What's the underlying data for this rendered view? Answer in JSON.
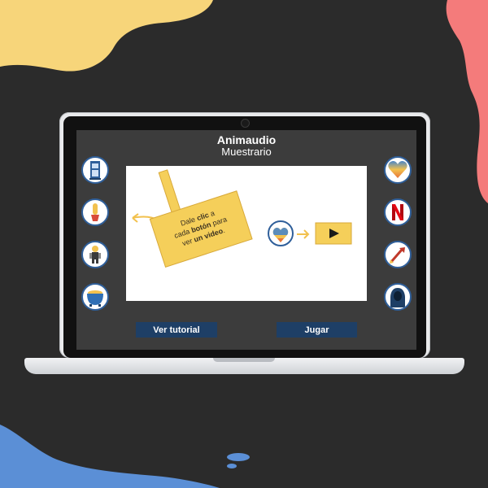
{
  "app": {
    "title": "Animaudio",
    "subtitle": "Muestrario"
  },
  "instructions": {
    "line1_a": "Dale ",
    "line1_b": "clic",
    "line1_c": " a",
    "line2_a": "cada ",
    "line2_b": "botón",
    "line2_c": " para",
    "line3_a": "ver ",
    "line3_b": "un video",
    "line3_c": "."
  },
  "buttons": {
    "tutorial_label": "Ver tutorial",
    "play_label": "Jugar"
  },
  "left_icons": [
    "phone-booth-icon",
    "potted-cactus-icon",
    "astronaut-icon",
    "cauldron-icon"
  ],
  "right_icons": [
    "heart-icon",
    "netflix-logo-icon",
    "arrow-rocket-icon",
    "hooded-figure-icon"
  ],
  "colors": {
    "background": "#2b2b2b",
    "blob_yellow": "#f7d57a",
    "blob_pink": "#f47b7b",
    "blob_blue": "#5b8fd6",
    "screen_bg": "#3c3c3c",
    "button_bg": "#1e3f66",
    "sign_yellow": "#f5cf5a",
    "icon_ring": "#2f5f9a"
  }
}
